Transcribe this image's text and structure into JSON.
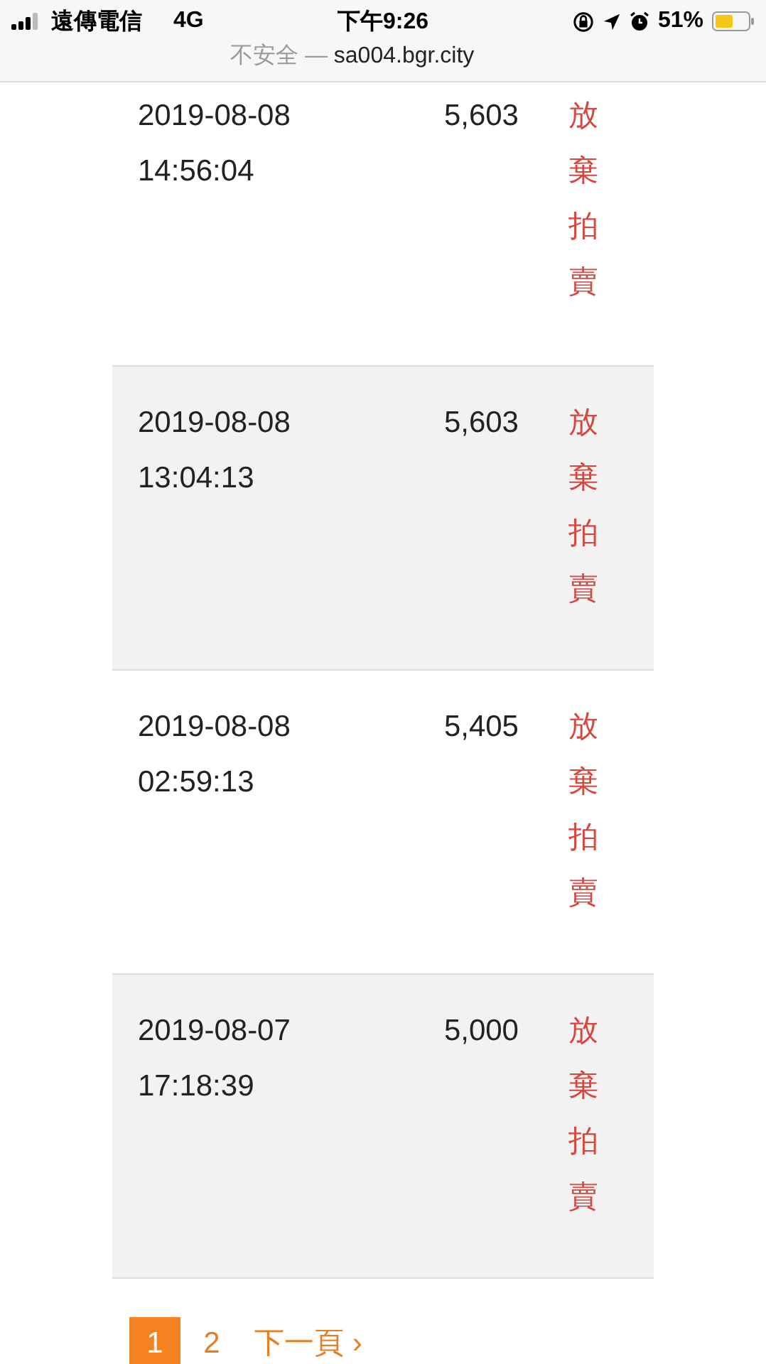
{
  "status_bar": {
    "carrier": "遠傳電信",
    "network": "4G",
    "time": "下午9:26",
    "battery": "51%"
  },
  "address_bar": {
    "security": "不安全",
    "separator": "—",
    "url": "sa004.bgr.city"
  },
  "bids": [
    {
      "time": "2019-08-08 14:56:04",
      "amount": "5,603",
      "action": "放棄拍賣"
    },
    {
      "time": "2019-08-08 13:04:13",
      "amount": "5,603",
      "action": "放棄拍賣"
    },
    {
      "time": "2019-08-08 02:59:13",
      "amount": "5,405",
      "action": "放棄拍賣"
    },
    {
      "time": "2019-08-07 17:18:39",
      "amount": "5,000",
      "action": "放棄拍賣"
    }
  ],
  "pagination": {
    "pages": [
      {
        "label": "1",
        "selected": true
      },
      {
        "label": "2",
        "selected": false
      }
    ],
    "next": "下一頁 ›"
  }
}
